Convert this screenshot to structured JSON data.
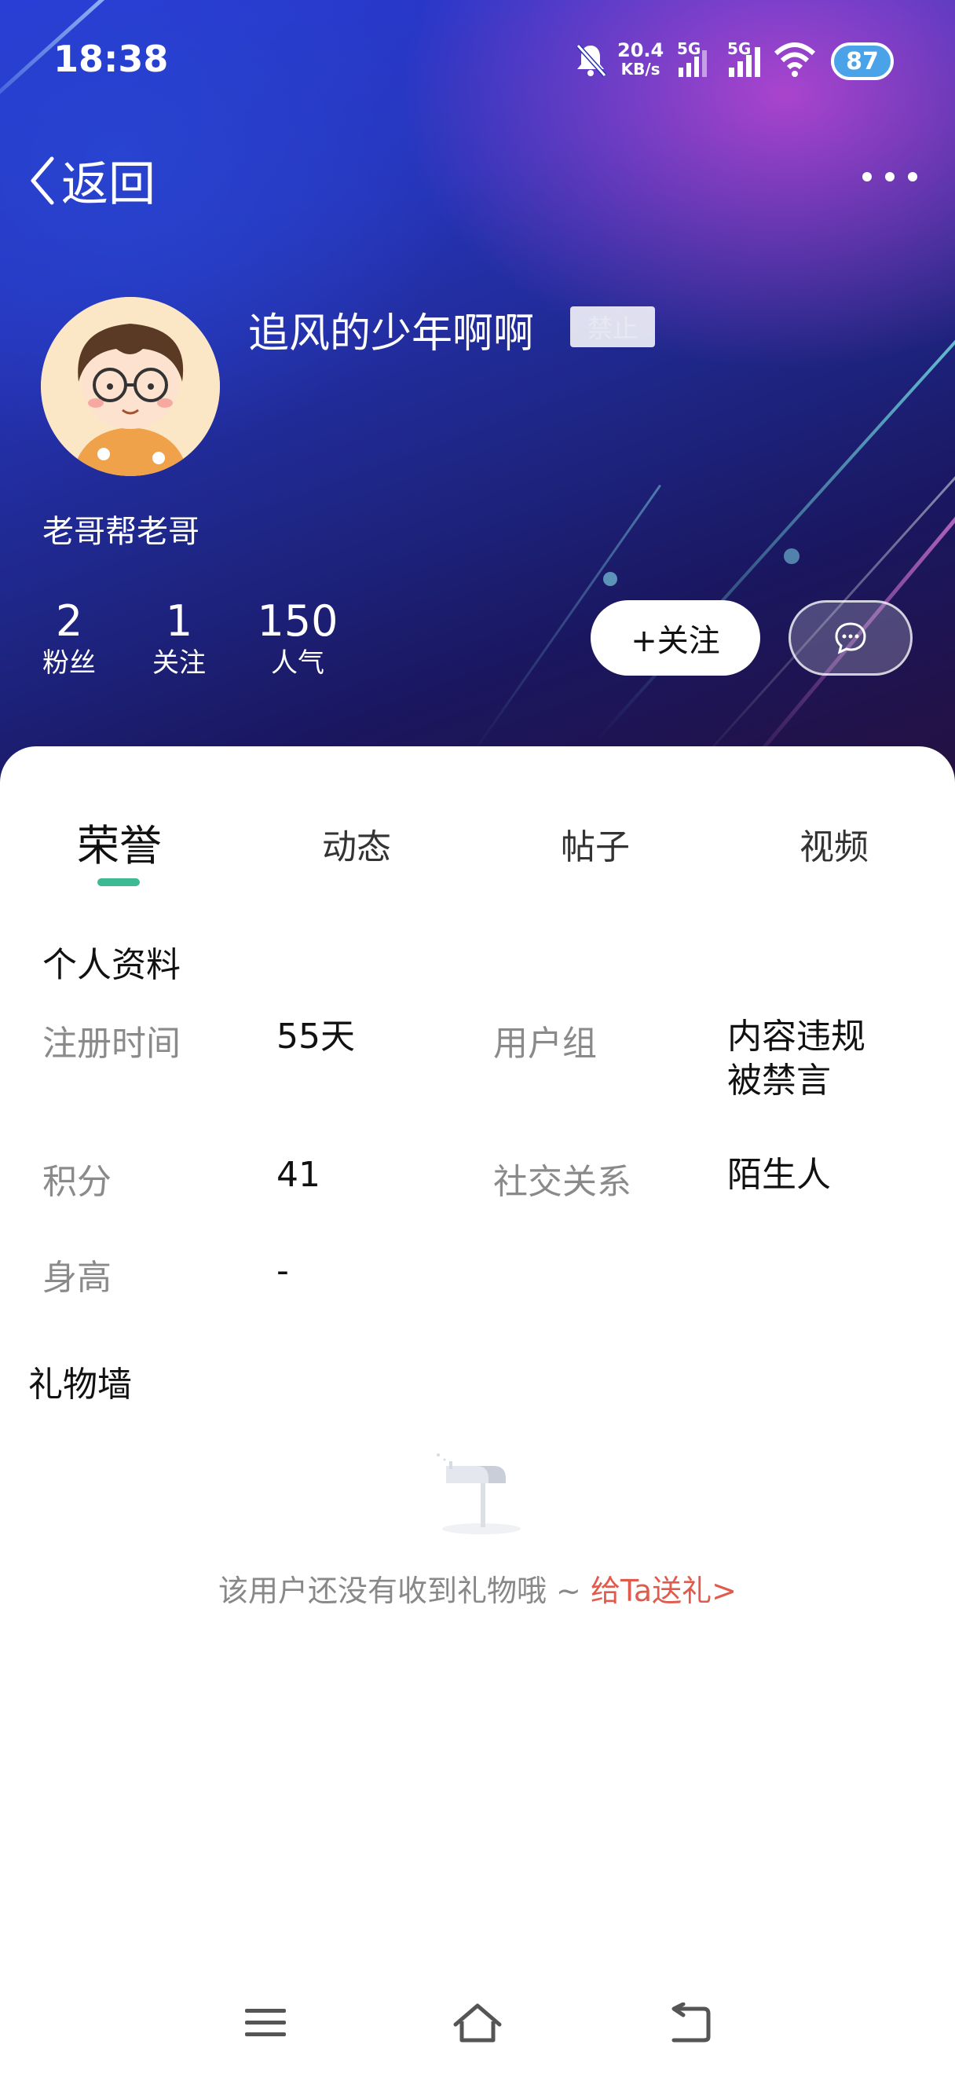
{
  "status_bar": {
    "time": "18:38",
    "net_speed_value": "20.4",
    "net_speed_unit": "KB/s",
    "signal1_label": "5G",
    "signal2_label": "5G",
    "battery": "87",
    "icons": [
      "mute-bell-icon",
      "signal-icon",
      "signal-icon",
      "wifi-icon",
      "battery-icon"
    ]
  },
  "nav": {
    "back_label": "返回",
    "more_icon": "more-dots-icon"
  },
  "profile": {
    "username": "追风的少年啊啊",
    "badge": "禁止",
    "signature": "老哥帮老哥",
    "stats": [
      {
        "value": "2",
        "label": "粉丝"
      },
      {
        "value": "1",
        "label": "关注"
      },
      {
        "value": "150",
        "label": "人气"
      }
    ],
    "follow_label": "+关注",
    "message_icon": "chat-bubble-icon"
  },
  "tabs": [
    {
      "label": "荣誉",
      "active": true
    },
    {
      "label": "动态",
      "active": false
    },
    {
      "label": "帖子",
      "active": false
    },
    {
      "label": "视频",
      "active": false
    }
  ],
  "colors": {
    "accent": "#3dba93",
    "link": "#e05a4e",
    "label_gray": "#8a8a8a"
  },
  "personal_info": {
    "title": "个人资料",
    "fields": [
      {
        "label": "注册时间",
        "value": "55天"
      },
      {
        "label": "用户组",
        "value_line1": "内容违规",
        "value_line2": "被禁言"
      },
      {
        "label": "积分",
        "value": "41"
      },
      {
        "label": "社交关系",
        "value": "陌生人"
      },
      {
        "label": "身高",
        "value": "-"
      }
    ]
  },
  "gift_wall": {
    "title": "礼物墙",
    "empty_text": "该用户还没有收到礼物哦 ~ ",
    "send_link": "给Ta送礼>"
  },
  "bottom_nav": {
    "icons": [
      "menu-icon",
      "home-icon",
      "back-icon"
    ]
  }
}
